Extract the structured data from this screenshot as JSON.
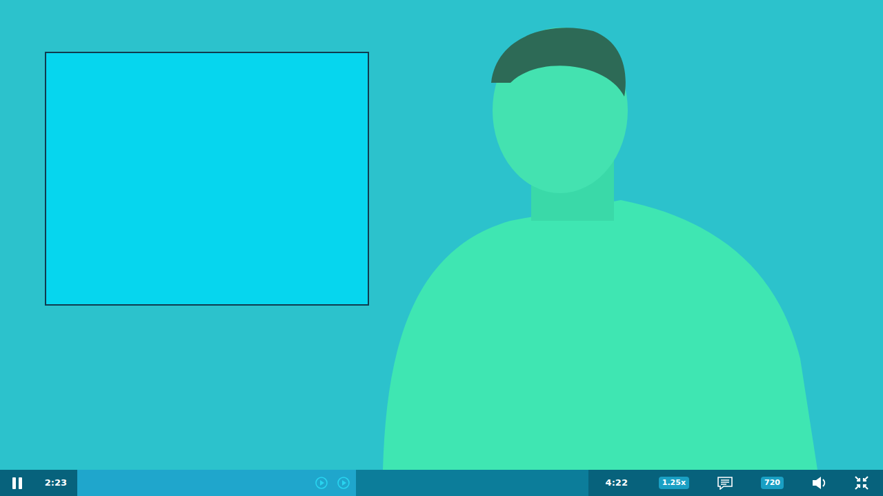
{
  "player": {
    "playing": true,
    "elapsed": "2:23",
    "duration": "4:22",
    "progress": {
      "level": 0.546
    },
    "speed": "1.25x",
    "quality": "720"
  }
}
